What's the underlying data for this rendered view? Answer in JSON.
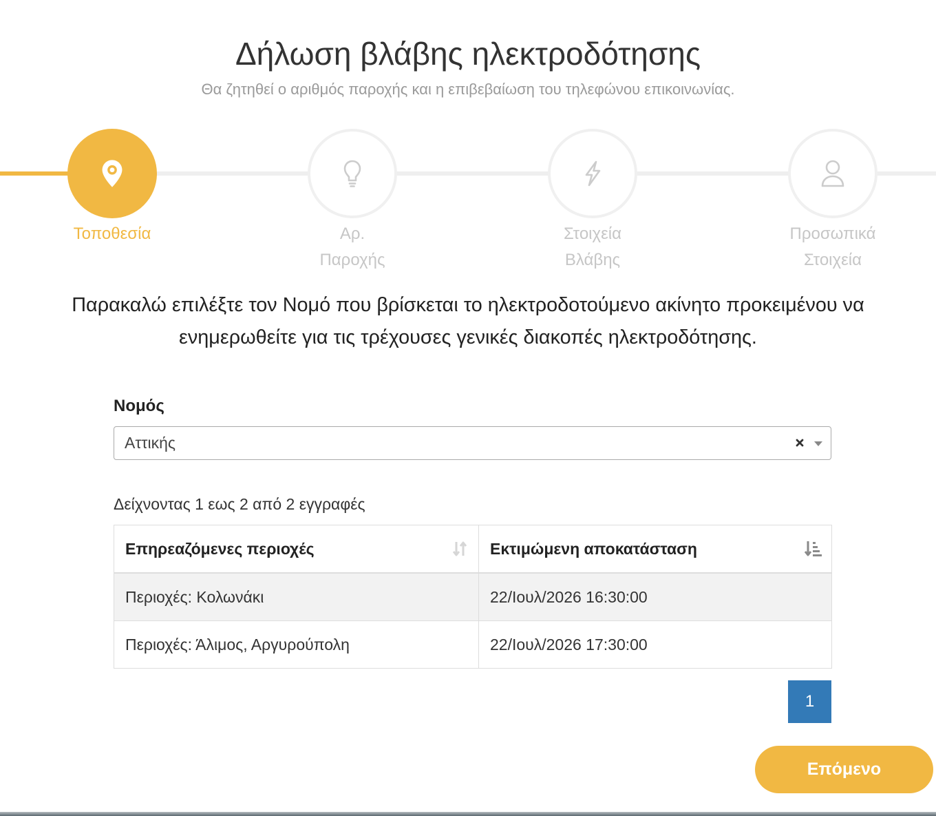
{
  "header": {
    "title": "Δήλωση βλάβης ηλεκτροδότησης",
    "subtitle": "Θα ζητηθεί ο αριθμός παροχής και η επιβεβαίωση του τηλεφώνου επικοινωνίας."
  },
  "stepper": {
    "steps": [
      {
        "label_lines": [
          "Τοποθεσία"
        ],
        "icon": "location-pin-icon",
        "active": true
      },
      {
        "label_lines": [
          "Αρ.",
          "Παροχής"
        ],
        "icon": "lightbulb-icon",
        "active": false
      },
      {
        "label_lines": [
          "Στοιχεία",
          "Βλάβης"
        ],
        "icon": "lightning-icon",
        "active": false
      },
      {
        "label_lines": [
          "Προσωπικά",
          "Στοιχεία"
        ],
        "icon": "person-icon",
        "active": false
      }
    ]
  },
  "instructions": {
    "line1": "Παρακαλώ επιλέξτε τον Νομό που βρίσκεται το ηλεκτροδοτούμενο ακίνητο προκειμένου να",
    "line2": "ενημερωθείτε για τις τρέχουσες γενικές διακοπές ηλεκτροδότησης."
  },
  "prefecture": {
    "label": "Νομός",
    "selected": "Αττικής",
    "clear_icon": "clear-icon",
    "arrow_icon": "chevron-down-icon"
  },
  "table": {
    "info": "Δείχνοντας 1 εως 2 από 2 εγγραφές",
    "columns": [
      {
        "label": "Επηρεαζόμενες περιοχές",
        "sort_icon": "sort-both-icon"
      },
      {
        "label": "Εκτιμώμενη αποκατάσταση",
        "sort_icon": "sort-amount-icon"
      }
    ],
    "rows": [
      [
        "Περιοχές: Κολωνάκι",
        "22/Ιουλ/2026 16:30:00"
      ],
      [
        "Περιοχές: Άλιμος, Αργυρούπολη",
        "22/Ιουλ/2026 17:30:00"
      ]
    ]
  },
  "pagination": {
    "pages": [
      "1"
    ],
    "current": "1"
  },
  "actions": {
    "next_label": "Επόμενο"
  },
  "colors": {
    "accent": "#F1B843",
    "pagination_active": "#337AB7",
    "inactive_step": "#C6C6C6"
  }
}
